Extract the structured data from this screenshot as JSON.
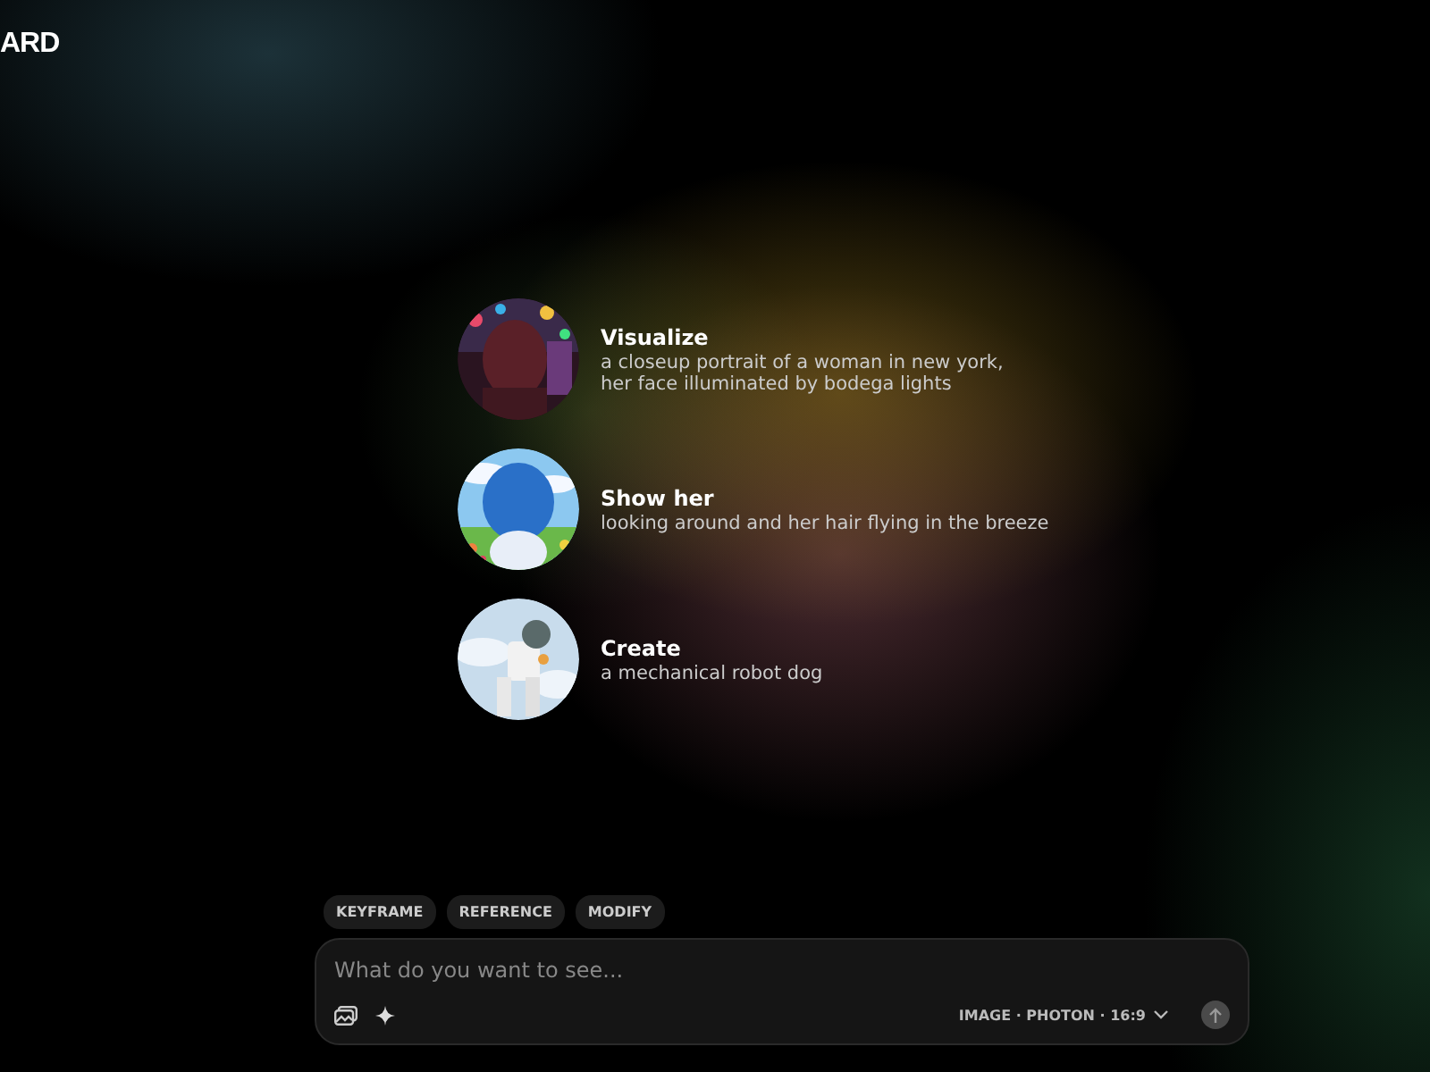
{
  "logo": "ARD",
  "suggestions": [
    {
      "title": "Visualize",
      "prompt": "a closeup portrait of a woman in new york,\nher face illuminated by bodega lights"
    },
    {
      "title": "Show her",
      "prompt": "looking around and her hair flying in the breeze"
    },
    {
      "title": "Create",
      "prompt": "a mechanical robot dog"
    }
  ],
  "modes": [
    "KEYFRAME",
    "REFERENCE",
    "MODIFY"
  ],
  "composer": {
    "placeholder": "What do you want to see...",
    "settings": "IMAGE · PHOTON · 16:9"
  }
}
